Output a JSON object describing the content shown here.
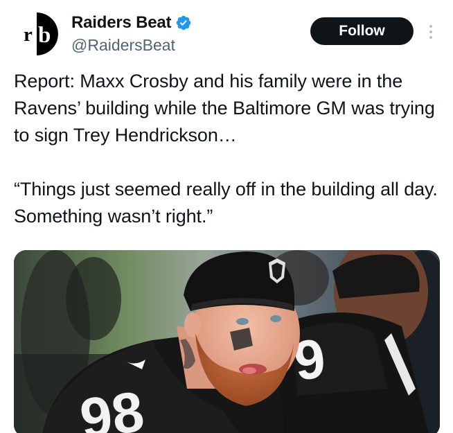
{
  "account": {
    "logo_text": "rb",
    "display_name": "Raiders Beat",
    "handle": "@RaidersBeat",
    "verified": true,
    "verified_icon": "verified-badge-icon",
    "verified_color": "#1d9bf0"
  },
  "actions": {
    "follow_label": "Follow",
    "more_icon": "more-vertical-icon"
  },
  "tweet": {
    "paragraph1": "Report: Maxx Crosby and his family were in the Ravens’ building while the Baltimore GM was trying to sign Trey Hendrickson…",
    "paragraph2": "“Things just seemed really off in the building all day. Something wasn’t right.”"
  },
  "media": {
    "type": "photo",
    "jersey_number_front": "98",
    "jersey_number_back": "9"
  },
  "colors": {
    "follow_bg": "#0f1419",
    "follow_text": "#ffffff",
    "text": "#0f1419",
    "secondary_text": "#536471"
  }
}
